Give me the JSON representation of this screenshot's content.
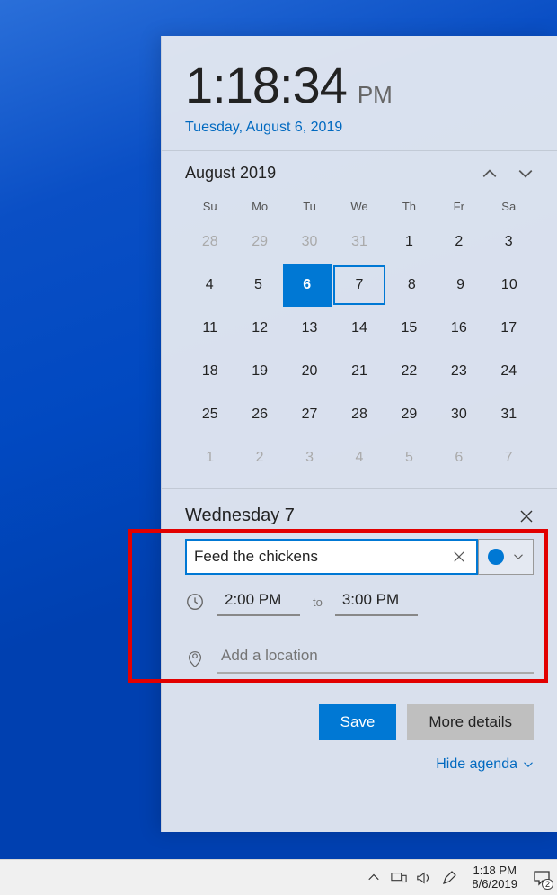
{
  "clock": {
    "time": "1:18:34",
    "ampm": "PM",
    "date_full": "Tuesday, August 6, 2019"
  },
  "calendar": {
    "month_label": "August 2019",
    "day_headers": [
      "Su",
      "Mo",
      "Tu",
      "We",
      "Th",
      "Fr",
      "Sa"
    ],
    "weeks": [
      [
        {
          "n": "28",
          "other": true
        },
        {
          "n": "29",
          "other": true
        },
        {
          "n": "30",
          "other": true
        },
        {
          "n": "31",
          "other": true
        },
        {
          "n": "1"
        },
        {
          "n": "2"
        },
        {
          "n": "3"
        }
      ],
      [
        {
          "n": "4"
        },
        {
          "n": "5"
        },
        {
          "n": "6",
          "today": true
        },
        {
          "n": "7",
          "selected": true
        },
        {
          "n": "8"
        },
        {
          "n": "9"
        },
        {
          "n": "10"
        }
      ],
      [
        {
          "n": "11"
        },
        {
          "n": "12"
        },
        {
          "n": "13"
        },
        {
          "n": "14"
        },
        {
          "n": "15"
        },
        {
          "n": "16"
        },
        {
          "n": "17"
        }
      ],
      [
        {
          "n": "18"
        },
        {
          "n": "19"
        },
        {
          "n": "20"
        },
        {
          "n": "21"
        },
        {
          "n": "22"
        },
        {
          "n": "23"
        },
        {
          "n": "24"
        }
      ],
      [
        {
          "n": "25"
        },
        {
          "n": "26"
        },
        {
          "n": "27"
        },
        {
          "n": "28"
        },
        {
          "n": "29"
        },
        {
          "n": "30"
        },
        {
          "n": "31"
        }
      ],
      [
        {
          "n": "1",
          "other": true
        },
        {
          "n": "2",
          "other": true
        },
        {
          "n": "3",
          "other": true
        },
        {
          "n": "4",
          "other": true
        },
        {
          "n": "5",
          "other": true
        },
        {
          "n": "6",
          "other": true
        },
        {
          "n": "7",
          "other": true
        }
      ]
    ]
  },
  "agenda": {
    "date_label": "Wednesday 7",
    "event_title": "Feed the chickens",
    "start_time": "2:00 PM",
    "to_label": "to",
    "end_time": "3:00 PM",
    "location_placeholder": "Add a location",
    "save_label": "Save",
    "more_label": "More details",
    "hide_label": "Hide agenda",
    "calendar_color": "#0078d4"
  },
  "taskbar": {
    "time": "1:18 PM",
    "date": "8/6/2019",
    "notification_count": "2"
  }
}
